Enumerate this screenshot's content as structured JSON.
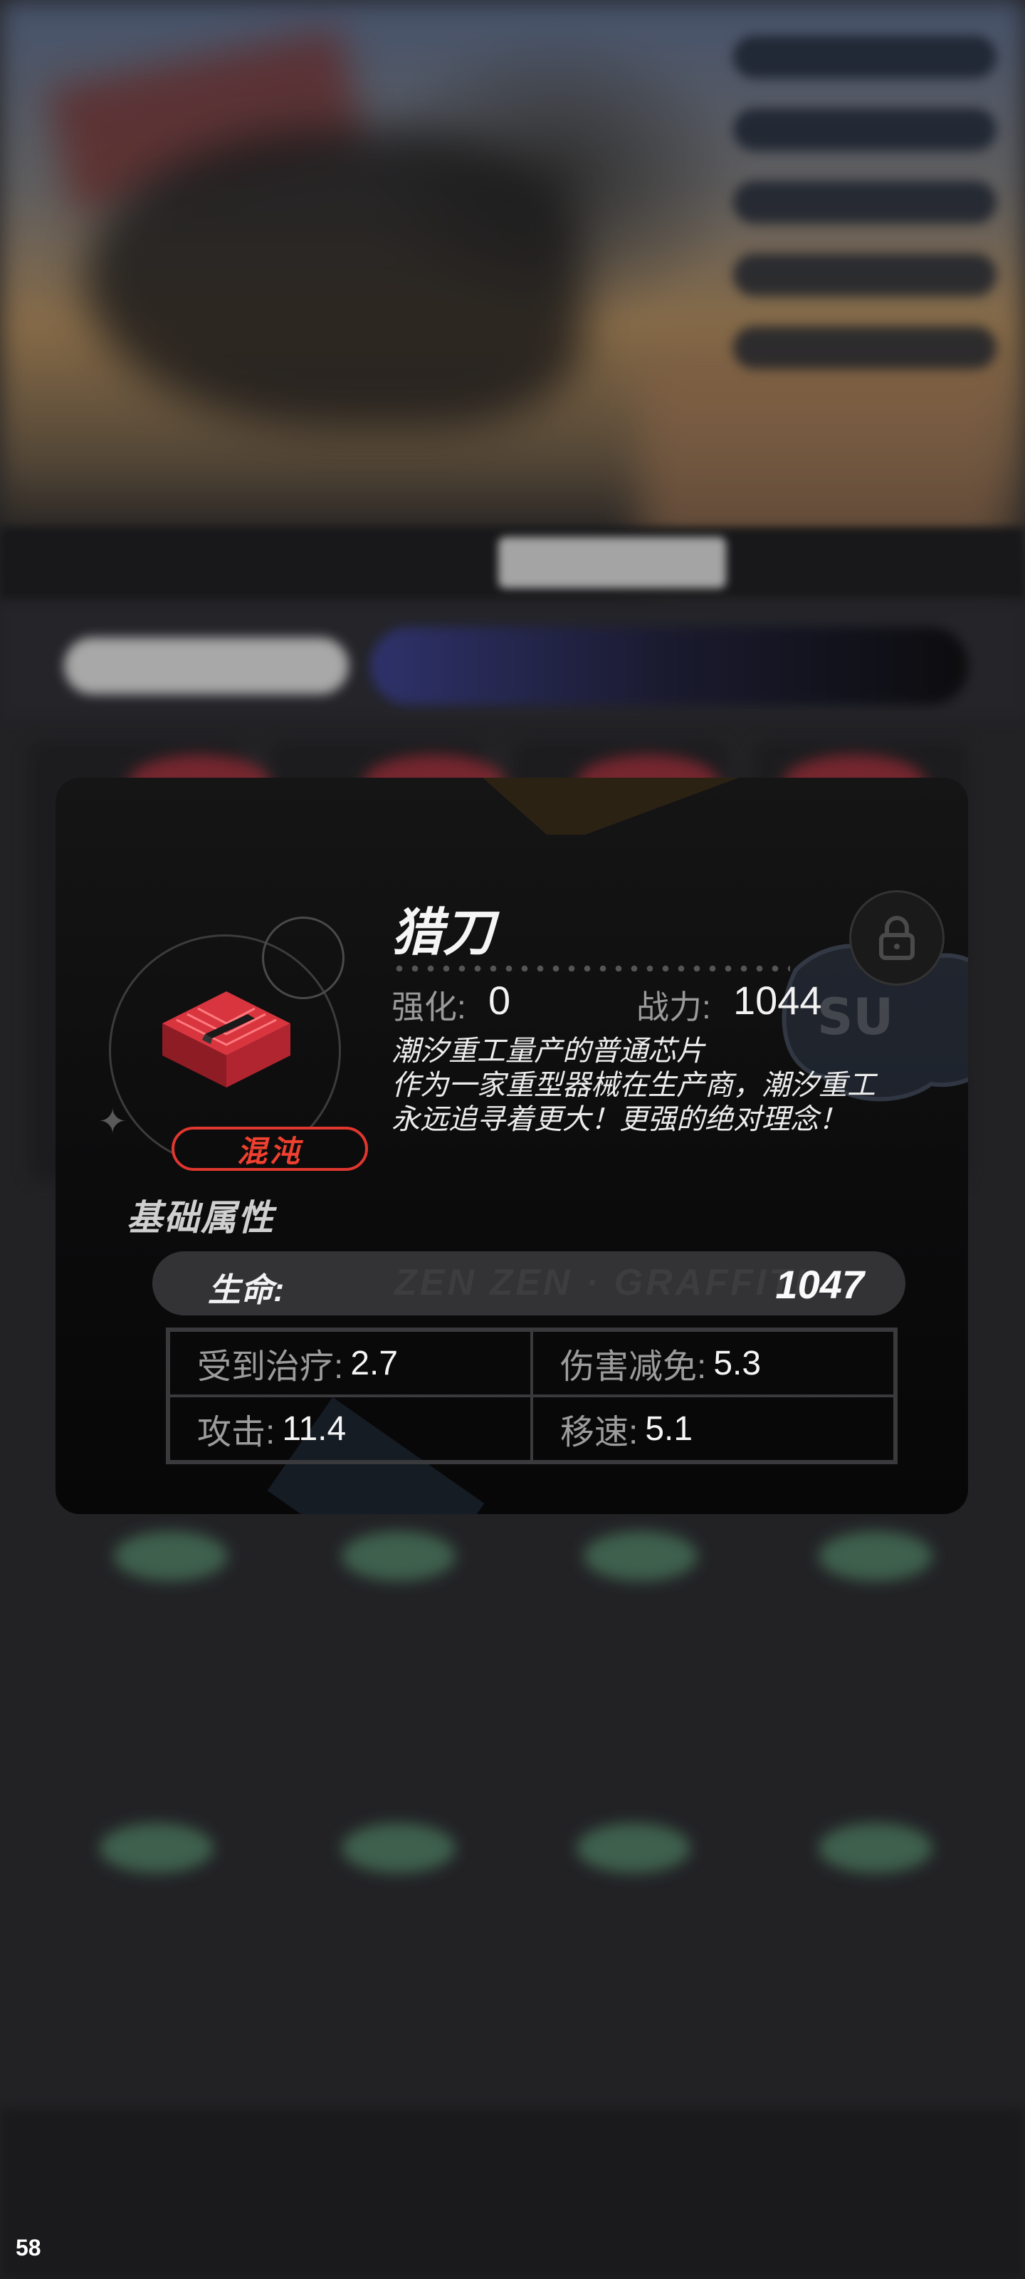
{
  "item": {
    "name": "猎刀",
    "rarity": "混沌",
    "enhance_label": "强化:",
    "enhance_value": "0",
    "power_label": "战力:",
    "power_value": "1044",
    "description": [
      "潮汐重工量产的普通芯片",
      "作为一家重型器械在生产商，潮汐重工",
      "永远追寻着更大！更强的绝对理念！"
    ]
  },
  "base_attributes": {
    "title": "基础属性",
    "life_label": "生命:",
    "life_value": "1047",
    "stats": [
      {
        "label": "受到治疗:",
        "value": "2.7"
      },
      {
        "label": "伤害减免:",
        "value": "5.3"
      },
      {
        "label": "攻击:",
        "value": "11.4"
      },
      {
        "label": "移速:",
        "value": "5.1"
      }
    ]
  },
  "icons": {
    "lock": "lock-icon",
    "chip": "chip-icon",
    "sparkle": "sparkle-icon"
  },
  "colors": {
    "rarity": "#e0372f",
    "chip_red": "#d8353f"
  },
  "overlay": {
    "fps": "58"
  }
}
